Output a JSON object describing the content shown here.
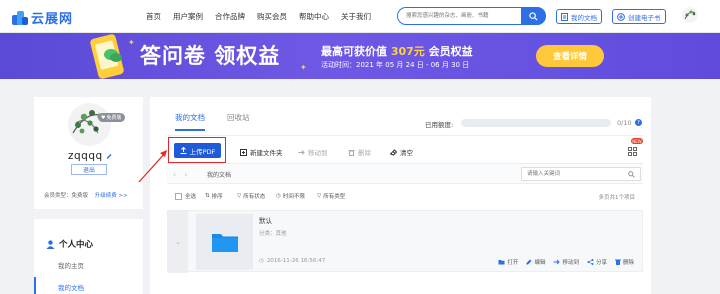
{
  "header": {
    "logo_text": "云展网",
    "nav": [
      "首页",
      "用户案例",
      "合作品牌",
      "购买会员",
      "帮助中心",
      "关于我们"
    ],
    "search_placeholder": "搜索您感兴趣的杂志、画册、书籍",
    "my_docs_btn": "我的文档",
    "create_ebook_btn": "创建电子书"
  },
  "banner": {
    "title": "答问卷 领权益",
    "headline_pre": "最高可获价值",
    "headline_amount": "307元",
    "headline_post": "会员权益",
    "period": "活动时间：2021 年 05 月 24 日 - 06 月 30 日",
    "cta": "查看详情"
  },
  "profile": {
    "vip_tag": "免费版",
    "username": "zqqqq",
    "logout": "退出",
    "member_type": "会员类型：免费版",
    "upgrade": "升级续费 >>"
  },
  "personal_center": {
    "title": "个人中心",
    "items": [
      "我的主页",
      "我的文档"
    ]
  },
  "main": {
    "tabs": [
      "我的文档",
      "回收站"
    ],
    "quota_label": "已用额度:",
    "quota_value": "0/10",
    "quota_fill": 0,
    "toolbar": {
      "upload": "上传PDF",
      "new_folder": "新建文件夹",
      "move": "移动到",
      "delete": "删除",
      "clear": "清空",
      "new_badge": "NEW"
    },
    "breadcrumb": "我的文档",
    "search_placeholder": "请输入关键词",
    "filters": {
      "select_all": "全选",
      "sort": "排序",
      "all_status": "所有状态",
      "all_time": "时间不限",
      "all_types": "所有类型",
      "total": "多页共1个项目"
    },
    "file": {
      "title": "默认",
      "category": "分类：其他",
      "date": "2016-11-26 16:56:47",
      "actions": [
        "打开",
        "编辑",
        "移动到",
        "分享",
        "删除"
      ]
    }
  },
  "colors": {
    "accent": "#2e6fe8",
    "banner_bg": "#6450de",
    "cta": "#ffc83a",
    "highlight": "#e02a2a"
  }
}
